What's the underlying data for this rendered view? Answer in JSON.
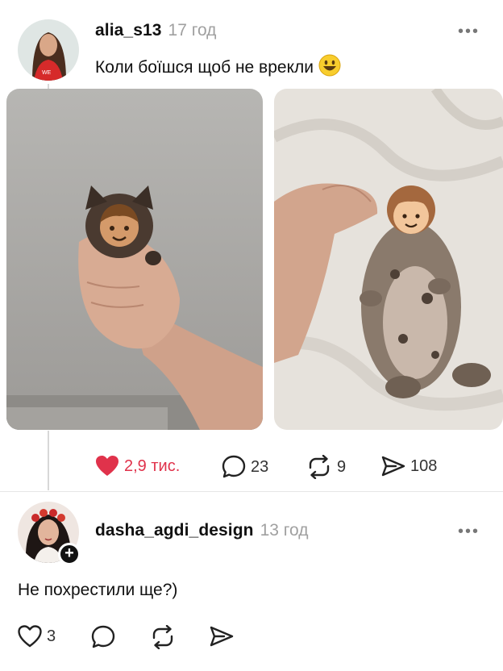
{
  "post": {
    "username": "alia_s13",
    "time": "17 год",
    "text": "Коли боїшся щоб не врекли",
    "text_emoji": "grinning-face",
    "actions": {
      "likes": "2,9 тис.",
      "liked": true,
      "comments": "23",
      "reposts": "9",
      "shares": "108"
    }
  },
  "reply": {
    "username": "dasha_agdi_design",
    "time": "13 год",
    "text": "Не похрестили ще?)",
    "actions": {
      "likes": "3"
    }
  },
  "colors": {
    "like_red": "#e0324b",
    "time_gray": "#a0a0a0"
  },
  "icons": [
    "heart-icon",
    "comment-icon",
    "repost-icon",
    "share-icon",
    "more-icon",
    "plus-icon"
  ]
}
